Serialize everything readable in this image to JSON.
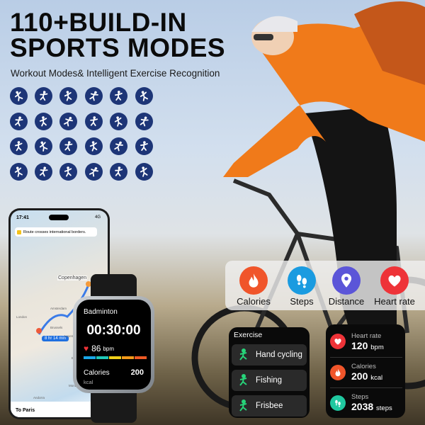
{
  "headline": {
    "line1": "110+BUILD-IN",
    "line2": "SPORTS MODES",
    "subtitle": "Workout Modes& Intelligent Exercise Recognition"
  },
  "sports_icons": [
    "badminton",
    "archery",
    "gymnastics",
    "weightlifting",
    "running",
    "boxing",
    "tennis",
    "yoga",
    "dance",
    "volleyball",
    "swimming",
    "kayaking",
    "rowing",
    "canoe",
    "sailing",
    "badminton-doubles",
    "bmx",
    "cricket",
    "cycling",
    "road-cycling",
    "triathlon",
    "flag",
    "equestrian",
    "wrestling"
  ],
  "phone": {
    "time": "17:41",
    "status": "4G",
    "alert": "Route crosses international borders.",
    "eta": "8 hr 14 min",
    "destination": "To Paris",
    "places": [
      "Amsterdam",
      "Brussels",
      "London",
      "Luxembourg",
      "Bern",
      "Monaco",
      "Andorra",
      "Copenhagen"
    ]
  },
  "watch": {
    "sport": "Badminton",
    "timer": "00:30:00",
    "heart_value": "86",
    "heart_unit": "bpm",
    "calories_label": "Calories",
    "calories_value": "200",
    "calories_unit": "kcal",
    "zone_colors": [
      "#1aa7e8",
      "#20c8b8",
      "#f0d01a",
      "#f39a1a",
      "#ee5a24"
    ]
  },
  "metrics": [
    {
      "label": "Calories",
      "icon": "flame-icon",
      "color": "#f0552a"
    },
    {
      "label": "Steps",
      "icon": "footprints-icon",
      "color": "#1a9be0"
    },
    {
      "label": "Distance",
      "icon": "location-pin-icon",
      "color": "#5b55d8"
    },
    {
      "label": "Heart rate",
      "icon": "heart-icon",
      "color": "#ee3338"
    }
  ],
  "exercise": {
    "title": "Exercise",
    "items": [
      {
        "label": "Hand cycling",
        "icon": "hand-cycling-icon"
      },
      {
        "label": "Fishing",
        "icon": "fishing-icon"
      },
      {
        "label": "Frisbee",
        "icon": "frisbee-icon"
      }
    ],
    "accent": "#27d57a"
  },
  "stats": [
    {
      "label": "Heart rate",
      "value": "120",
      "unit": "bpm",
      "color": "#ee3338",
      "icon": "heart-icon"
    },
    {
      "label": "Calories",
      "value": "200",
      "unit": "kcal",
      "color": "#f0552a",
      "icon": "flame-icon"
    },
    {
      "label": "Steps",
      "value": "2038",
      "unit": "steps",
      "color": "#20c8a0",
      "icon": "footprints-icon"
    }
  ]
}
